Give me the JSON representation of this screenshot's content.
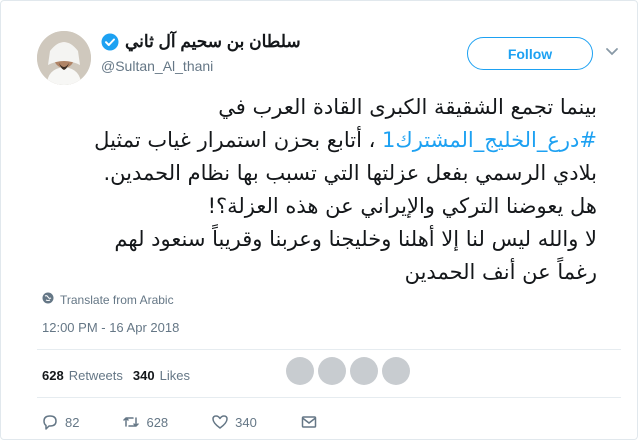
{
  "user": {
    "display_name": "سلطان بن سحيم آل ثاني",
    "handle": "@Sultan_Al_thani",
    "verified": true
  },
  "follow_button": {
    "label": "Follow"
  },
  "tweet": {
    "line1": "بينما تجمع الشقيقة الكبرى القادة العرب في",
    "hashtag": "#درع_الخليج_المشترك1",
    "line2_rest": " ، أتابع بحزن استمرار غياب تمثيل",
    "line3": "بلادي الرسمي بفعل عزلتها التي تسبب بها نظام الحمدين.",
    "line4": "هل يعوضنا التركي والإيراني عن هذه العزلة؟!",
    "line5": "لا والله ليس لنا إلا أهلنا وخليجنا وعربنا وقريباً سنعود لهم",
    "line6": "رغماً عن أنف الحمدين"
  },
  "translate_label": "Translate from Arabic",
  "timestamp": "12:00 PM - 16 Apr 2018",
  "stats": {
    "retweets_count": "628",
    "retweets_label": "Retweets",
    "likes_count": "340",
    "likes_label": "Likes"
  },
  "actions": {
    "reply_count": "82",
    "retweet_count": "628",
    "like_count": "340"
  },
  "colors": {
    "accent": "#1da1f2",
    "muted": "#657786",
    "text": "#14171a"
  },
  "icons": [
    "verified-badge-icon",
    "chevron-down-icon",
    "globe-icon",
    "reply-icon",
    "retweet-icon",
    "like-icon",
    "dm-icon"
  ]
}
